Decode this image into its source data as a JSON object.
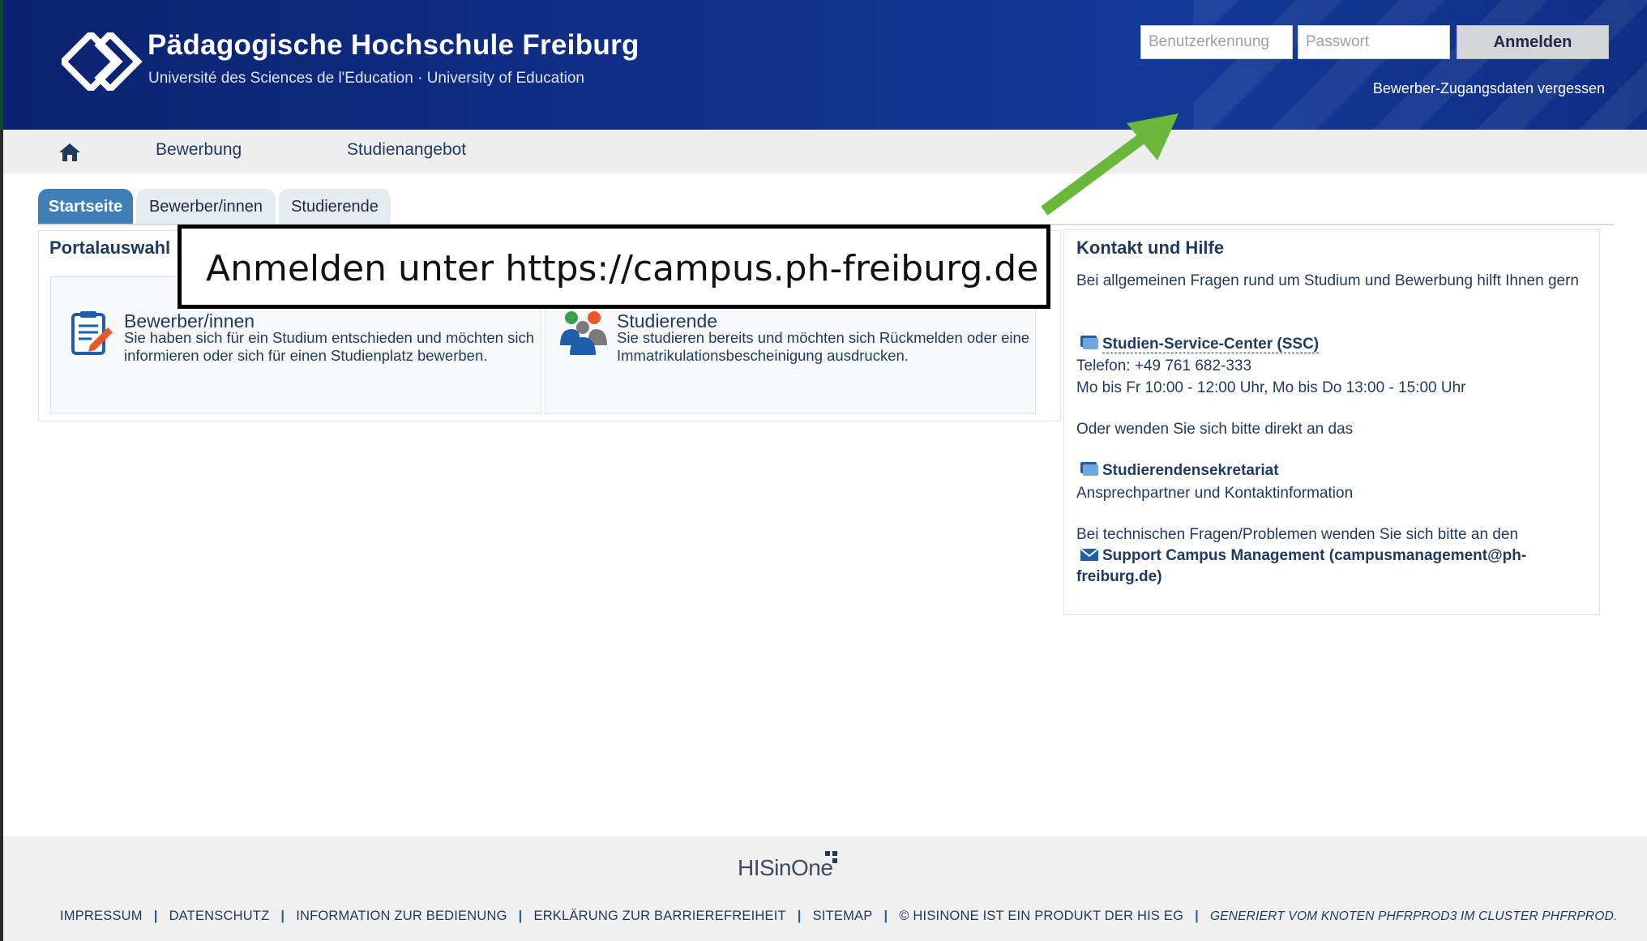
{
  "header": {
    "title": "Pädagogische Hochschule Freiburg",
    "subtitle": "Université des Sciences de l'Education · University of Education",
    "login": {
      "username_placeholder": "Benutzerkennung",
      "password_placeholder": "Passwort",
      "login_button": "Anmelden",
      "forgot_link": "Bewerber-Zugangsdaten vergessen"
    }
  },
  "nav": {
    "items": [
      "Bewerbung",
      "Studienangebot"
    ]
  },
  "tabs": [
    "Startseite",
    "Bewerber/innen",
    "Studierende"
  ],
  "portal": {
    "title": "Portalauswahl",
    "cards": [
      {
        "title": "Bewerber/innen",
        "desc": "Sie haben sich für ein Studium entschieden und möchten sich informieren oder sich für einen Studienplatz bewerben."
      },
      {
        "title": "Studierende",
        "desc": "Sie studieren bereits und möchten sich Rückmelden oder eine Immatrikulationsbescheinigung ausdrucken."
      }
    ]
  },
  "callout": {
    "text": "Anmelden unter https://campus.ph-freiburg.de"
  },
  "contact": {
    "title": "Kontakt und Hilfe",
    "intro": "Bei allgemeinen Fragen rund um Studium und Bewerbung hilft Ihnen gern",
    "ssc_link": "Studien-Service-Center (SSC)",
    "phone": "Telefon: +49 761 682-333",
    "hours": "Mo bis Fr 10:00 - 12:00 Uhr, Mo bis Do 13:00 - 15:00 Uhr",
    "alt_text": "Oder wenden Sie sich bitte direkt an das",
    "sekretariat_link": "Studierendensekretariat",
    "sekretariat_desc": "Ansprechpartner und Kontaktinformation",
    "tech_text": "Bei technischen Fragen/Problemen wenden Sie sich bitte an den",
    "support_link": "Support Campus Management (campusmanagement@ph-freiburg.de)"
  },
  "footer": {
    "logo": "HISinOne",
    "links": [
      "IMPRESSUM",
      "DATENSCHUTZ",
      "INFORMATION ZUR BEDIENUNG",
      "ERKLÄRUNG ZUR BARRIEREFREIHEIT",
      "SITEMAP",
      "© HISINONE IST EIN PRODUKT DER HIS EG"
    ],
    "generated": "GENERIERT VOM KNOTEN PHFRPROD3 IM CLUSTER PHFRPROD."
  },
  "colors": {
    "header_bg": "#10318a",
    "tab_active": "#3f7fb6",
    "arrow": "#6ab83a",
    "text": "#1f3a5c"
  }
}
